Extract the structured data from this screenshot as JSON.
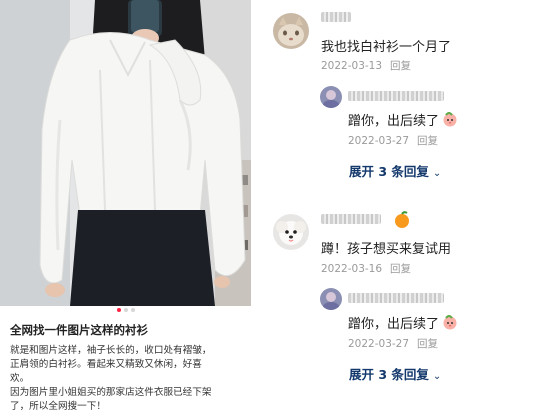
{
  "post": {
    "title": "全网找一件图片这样的衬衫",
    "body_lines": [
      "就是和图片这样，袖子长长的，收口处有褶皱，",
      "正肩领的白衬衫。看起来又精致又休闲，好喜",
      "欢。",
      "因为图片里小姐姐买的那家店这件衣服已经下架",
      "了，所以全网搜一下！"
    ],
    "carousel": {
      "count": 3,
      "active_index": 0
    }
  },
  "comments": [
    {
      "text": "我也找白衬衫一个月了",
      "date": "2022-03-13",
      "reply_label": "回复",
      "reply": {
        "text": "蹭你，出后续了",
        "date": "2022-03-27",
        "emoji": "peach-icon"
      },
      "expand_label": "展开 3 条回复"
    },
    {
      "text": "蹲！孩子想买来复试用",
      "date": "2022-03-16",
      "reply_label": "回复",
      "badge": "orange-icon",
      "reply": {
        "text": "蹭你，出后续了",
        "date": "2022-03-27",
        "emoji": "peach-icon"
      },
      "expand_label": "展开 3 条回复"
    }
  ],
  "colors": {
    "accent_red": "#ff2442",
    "expand_blue": "#13386c",
    "meta_gray": "#9a9a9a"
  }
}
